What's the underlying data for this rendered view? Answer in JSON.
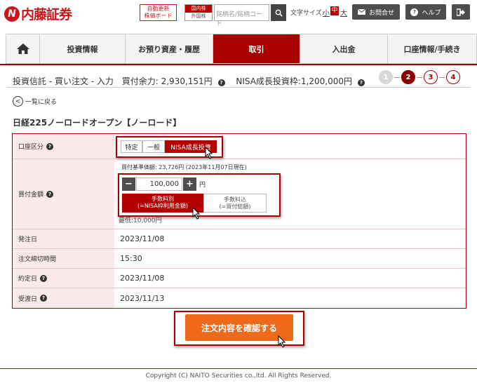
{
  "header": {
    "logo_text": "内藤証券",
    "logo_mark": "N",
    "auto_refresh_line1": "自動更新",
    "auto_refresh_line2": "株価ボード",
    "market_domestic": "国内株",
    "market_foreign": "外国株",
    "search_placeholder": "銘柄名/銘柄コード",
    "font_size_label": "文字サイズ:",
    "font_small": "小",
    "font_medium": "中",
    "font_large": "大",
    "contact_label": "お問合せ",
    "help_label": "ヘルプ"
  },
  "nav": {
    "items": [
      {
        "label": "投資情報"
      },
      {
        "label": "お預り資産・履歴"
      },
      {
        "label": "取引"
      },
      {
        "label": "入出金"
      },
      {
        "label": "口座情報/手続き"
      }
    ]
  },
  "subheader": {
    "title": "投資信託 - 買い注文 - 入力",
    "buying_power": "買付余力: 2,930,151円",
    "nisa_quota": "NISA成長投資枠:1,200,000円"
  },
  "steps": [
    "1",
    "2",
    "3",
    "4"
  ],
  "back_label": "一覧に戻る",
  "fund_name": "日経225ノーロードオープン【ノーロード】",
  "form": {
    "account_label": "口座区分",
    "account_options": [
      "特定",
      "一般",
      "NISA成長投資"
    ],
    "amount_label": "買付金額",
    "nav_price_note": "買付基準価額: 23,726円 (2023年11月07日現在)",
    "amount_value": "100,000",
    "amount_unit": "円",
    "fee_option_1_line1": "手数料別",
    "fee_option_1_line2": "(=NISA枠利用金額)",
    "fee_option_2_line1": "手数料込",
    "fee_option_2_line2": "(=買付総額)",
    "min_note": "最低:10,000円",
    "order_date_label": "発注日",
    "order_date_value": "2023/11/08",
    "cutoff_label": "注文締切時間",
    "cutoff_value": "15:30",
    "contract_date_label": "約定日",
    "contract_date_value": "2023/11/08",
    "delivery_date_label": "受渡日",
    "delivery_date_value": "2023/11/13"
  },
  "confirm_label": "注文内容を確認する",
  "copyright": "Copyright (C) NAITO Securities co.,ltd. All Rights Reserved.",
  "colors": {
    "brand_red": "#a60000",
    "accent_orange": "#ee6a1a"
  }
}
